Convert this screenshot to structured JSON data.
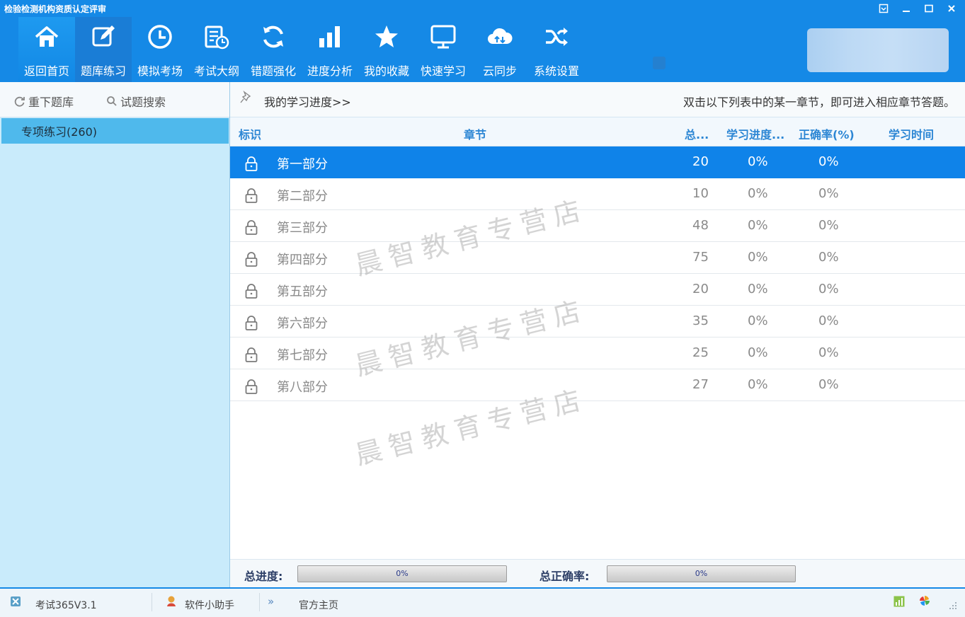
{
  "window": {
    "title": "检验检测机构资质认定评审",
    "controls": [
      "menu-icon",
      "minimize-icon",
      "maximize-icon",
      "close-icon"
    ]
  },
  "toolbar": {
    "items": [
      {
        "label": "返回首页",
        "icon": "home-icon"
      },
      {
        "label": "题库练习",
        "icon": "edit-icon"
      },
      {
        "label": "模拟考场",
        "icon": "clock-icon"
      },
      {
        "label": "考试大纲",
        "icon": "notepad-clock-icon"
      },
      {
        "label": "错题强化",
        "icon": "refresh-icon"
      },
      {
        "label": "进度分析",
        "icon": "bar-chart-icon"
      },
      {
        "label": "我的收藏",
        "icon": "star-icon"
      },
      {
        "label": "快速学习",
        "icon": "monitor-icon"
      },
      {
        "label": "云同步",
        "icon": "cloud-sync-icon"
      },
      {
        "label": "系统设置",
        "icon": "shuffle-icon"
      }
    ],
    "active_index": 1
  },
  "sidebar": {
    "reload_label": "重下题库",
    "search_label": "试题搜索",
    "item_label": "专项练习(260)"
  },
  "main": {
    "progress_link": "我的学习进度>>",
    "hint": "双击以下列表中的某一章节，即可进入相应章节答题。",
    "columns": {
      "mark": "标识",
      "chapter": "章节",
      "total": "总...",
      "progress": "学习进度...",
      "accuracy": "正确率(%)",
      "time": "学习时间"
    },
    "rows": [
      {
        "chapter": "第一部分",
        "total": "20",
        "progress": "0%",
        "accuracy": "0%",
        "time": ""
      },
      {
        "chapter": "第二部分",
        "total": "10",
        "progress": "0%",
        "accuracy": "0%",
        "time": ""
      },
      {
        "chapter": "第三部分",
        "total": "48",
        "progress": "0%",
        "accuracy": "0%",
        "time": ""
      },
      {
        "chapter": "第四部分",
        "total": "75",
        "progress": "0%",
        "accuracy": "0%",
        "time": ""
      },
      {
        "chapter": "第五部分",
        "total": "20",
        "progress": "0%",
        "accuracy": "0%",
        "time": ""
      },
      {
        "chapter": "第六部分",
        "total": "35",
        "progress": "0%",
        "accuracy": "0%",
        "time": ""
      },
      {
        "chapter": "第七部分",
        "total": "25",
        "progress": "0%",
        "accuracy": "0%",
        "time": ""
      },
      {
        "chapter": "第八部分",
        "total": "27",
        "progress": "0%",
        "accuracy": "0%",
        "time": ""
      }
    ],
    "selected_row": 0,
    "watermark": "晨智教育专营店"
  },
  "footer": {
    "total_progress_label": "总进度:",
    "total_progress_value": "0%",
    "total_accuracy_label": "总正确率:",
    "total_accuracy_value": "0%"
  },
  "statusbar": {
    "version": "考试365V3.1",
    "helper": "软件小助手",
    "homepage": "官方主页"
  },
  "colors": {
    "accent": "#1589e6",
    "selected_row": "#0f83e9",
    "sidebar_bg": "#c9ebfb",
    "sidebar_selected": "#4fb9ec",
    "header_text": "#2c86d4"
  }
}
